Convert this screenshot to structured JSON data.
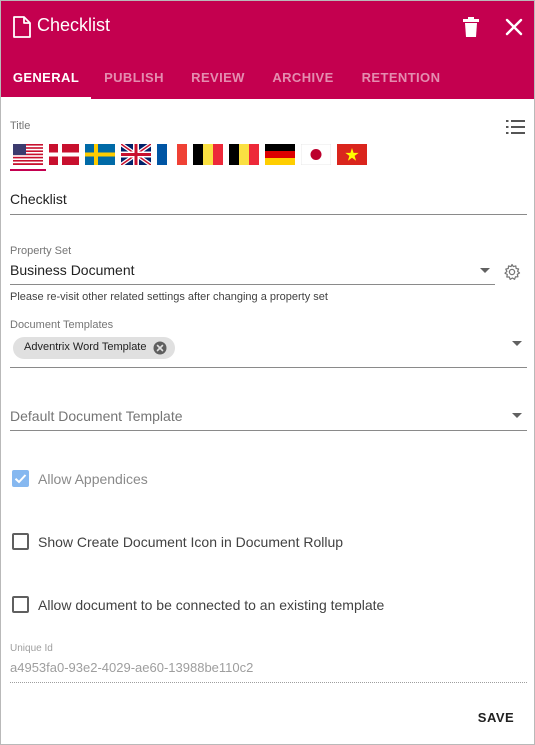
{
  "dialog": {
    "title": "Checklist",
    "header_icon": "document-icon",
    "delete_icon": "trash-icon",
    "close_icon": "close-icon",
    "accent_color": "#c4004f"
  },
  "tabs": [
    {
      "label": "GENERAL",
      "active": true
    },
    {
      "label": "PUBLISH",
      "active": false
    },
    {
      "label": "REVIEW",
      "active": false
    },
    {
      "label": "ARCHIVE",
      "active": false
    },
    {
      "label": "RETENTION",
      "active": false
    }
  ],
  "title_field": {
    "label": "Title",
    "value": "Checklist",
    "language_flags": [
      "us-flag-icon",
      "denmark-flag-icon",
      "sweden-flag-icon",
      "uk-flag-icon",
      "france-flag-icon",
      "belgium-flag-icon",
      "belgium-flag-icon",
      "germany-flag-icon",
      "japan-flag-icon",
      "vietnam-flag-icon"
    ],
    "selected_flag": "us-flag-icon",
    "list_icon": "list-icon"
  },
  "property_set": {
    "label": "Property Set",
    "value": "Business Document",
    "hint": "Please re-visit other related settings after changing a property set",
    "settings_icon": "gear-icon"
  },
  "document_templates": {
    "label": "Document Templates",
    "chips": [
      "Adventrix Word Template"
    ]
  },
  "default_template": {
    "placeholder": "Default Document Template"
  },
  "checkboxes": [
    {
      "label": "Allow Appendices",
      "checked": true,
      "disabled": true
    },
    {
      "label": "Show Create Document Icon in Document Rollup",
      "checked": false,
      "disabled": false
    },
    {
      "label": "Allow document to be connected to an existing template",
      "checked": false,
      "disabled": false
    }
  ],
  "unique_id": {
    "label": "Unique Id",
    "value": "a4953fa0-93e2-4029-ae60-13988be110c2"
  },
  "footer": {
    "save_label": "SAVE"
  }
}
